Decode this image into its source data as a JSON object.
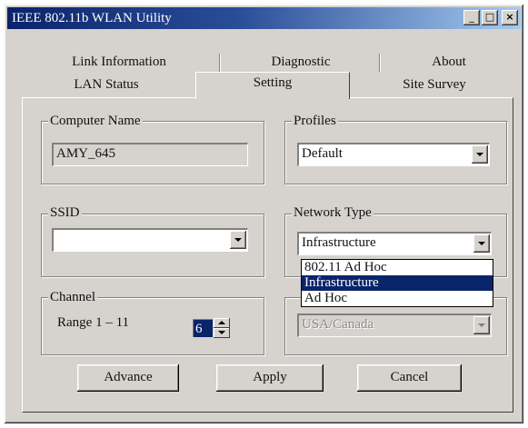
{
  "window": {
    "title": "IEEE 802.11b WLAN Utility",
    "minimize_glyph": "_",
    "maximize_glyph": "□",
    "close_glyph": "×"
  },
  "tabs": {
    "row1": [
      "Link Information",
      "Diagnostic",
      "About"
    ],
    "row2": [
      "LAN Status",
      "Setting",
      "Site Survey"
    ],
    "active": "Setting"
  },
  "computer_name": {
    "label": "Computer Name",
    "value": "AMY_645"
  },
  "profiles": {
    "label": "Profiles",
    "value": "Default"
  },
  "ssid": {
    "label": "SSID",
    "value": ""
  },
  "network_type": {
    "label": "Network Type",
    "value": "Infrastructure",
    "options": [
      "802.11 Ad Hoc",
      "Infrastructure",
      "Ad Hoc"
    ],
    "highlighted": "Infrastructure"
  },
  "channel": {
    "label": "Channel",
    "range_text": "Range 1 – 11",
    "value": "6"
  },
  "country": {
    "value": "USA/Canada"
  },
  "buttons": {
    "advance": "Advance",
    "apply": "Apply",
    "cancel": "Cancel"
  },
  "colors": {
    "title_bar": "#0a246a",
    "face": "#d6d3ce",
    "highlight": "#0a246a"
  },
  "icons": [
    "minimize-icon",
    "maximize-icon",
    "close-icon",
    "chevron-down-icon",
    "spin-up-icon",
    "spin-down-icon"
  ]
}
